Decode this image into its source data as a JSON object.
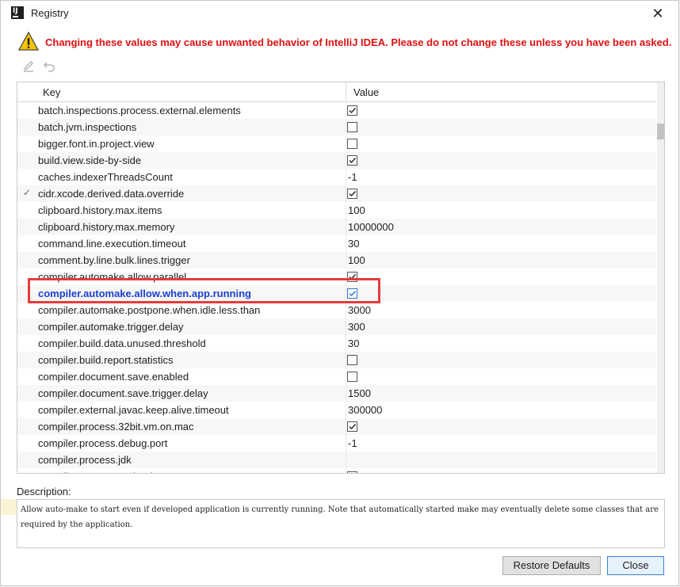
{
  "window": {
    "title": "Registry"
  },
  "warning": {
    "text": "Changing these values may cause unwanted behavior of IntelliJ IDEA. Please do not change these unless you have been asked."
  },
  "table": {
    "headers": {
      "key": "Key",
      "value": "Value"
    },
    "rows": [
      {
        "key": "batch.inspections.process.external.elements",
        "type": "checkbox",
        "checked": true
      },
      {
        "key": "batch.jvm.inspections",
        "type": "checkbox",
        "checked": false
      },
      {
        "key": "bigger.font.in.project.view",
        "type": "checkbox",
        "checked": false
      },
      {
        "key": "build.view.side-by-side",
        "type": "checkbox",
        "checked": true
      },
      {
        "key": "caches.indexerThreadsCount",
        "type": "text",
        "value": "-1"
      },
      {
        "key": "cidr.xcode.derived.data.override",
        "type": "checkbox",
        "checked": true,
        "modified": true
      },
      {
        "key": "clipboard.history.max.items",
        "type": "text",
        "value": "100"
      },
      {
        "key": "clipboard.history.max.memory",
        "type": "text",
        "value": "10000000"
      },
      {
        "key": "command.line.execution.timeout",
        "type": "text",
        "value": "30"
      },
      {
        "key": "comment.by.line.bulk.lines.trigger",
        "type": "text",
        "value": "100"
      },
      {
        "key": "compiler.automake.allow.parallel",
        "type": "checkbox",
        "checked": true
      },
      {
        "key": "compiler.automake.allow.when.app.running",
        "type": "checkbox",
        "checked": true,
        "selected": true
      },
      {
        "key": "compiler.automake.postpone.when.idle.less.than",
        "type": "text",
        "value": "3000"
      },
      {
        "key": "compiler.automake.trigger.delay",
        "type": "text",
        "value": "300"
      },
      {
        "key": "compiler.build.data.unused.threshold",
        "type": "text",
        "value": "30"
      },
      {
        "key": "compiler.build.report.statistics",
        "type": "checkbox",
        "checked": false
      },
      {
        "key": "compiler.document.save.enabled",
        "type": "checkbox",
        "checked": false
      },
      {
        "key": "compiler.document.save.trigger.delay",
        "type": "text",
        "value": "1500"
      },
      {
        "key": "compiler.external.javac.keep.alive.timeout",
        "type": "text",
        "value": "300000"
      },
      {
        "key": "compiler.process.32bit.vm.on.mac",
        "type": "checkbox",
        "checked": true
      },
      {
        "key": "compiler.process.debug.port",
        "type": "text",
        "value": "-1"
      },
      {
        "key": "compiler.process.jdk",
        "type": "text",
        "value": ""
      },
      {
        "key": "compiler.process.preload",
        "type": "checkbox",
        "checked": true
      }
    ]
  },
  "description": {
    "label": "Description:",
    "text": "Allow auto-make to start even if developed application is currently running. Note that automatically started make may eventually delete some classes that are required by the application."
  },
  "buttons": {
    "restore": "Restore Defaults",
    "close": "Close"
  },
  "colors": {
    "warning": "#e01010",
    "selected_key": "#1a3fcf",
    "highlight": "#e53c3c"
  },
  "icons": {
    "app": "intellij-icon",
    "warning": "warning-triangle-icon",
    "edit": "pencil-icon",
    "revert": "undo-icon",
    "close": "close-icon",
    "check": "checkmark-icon"
  }
}
